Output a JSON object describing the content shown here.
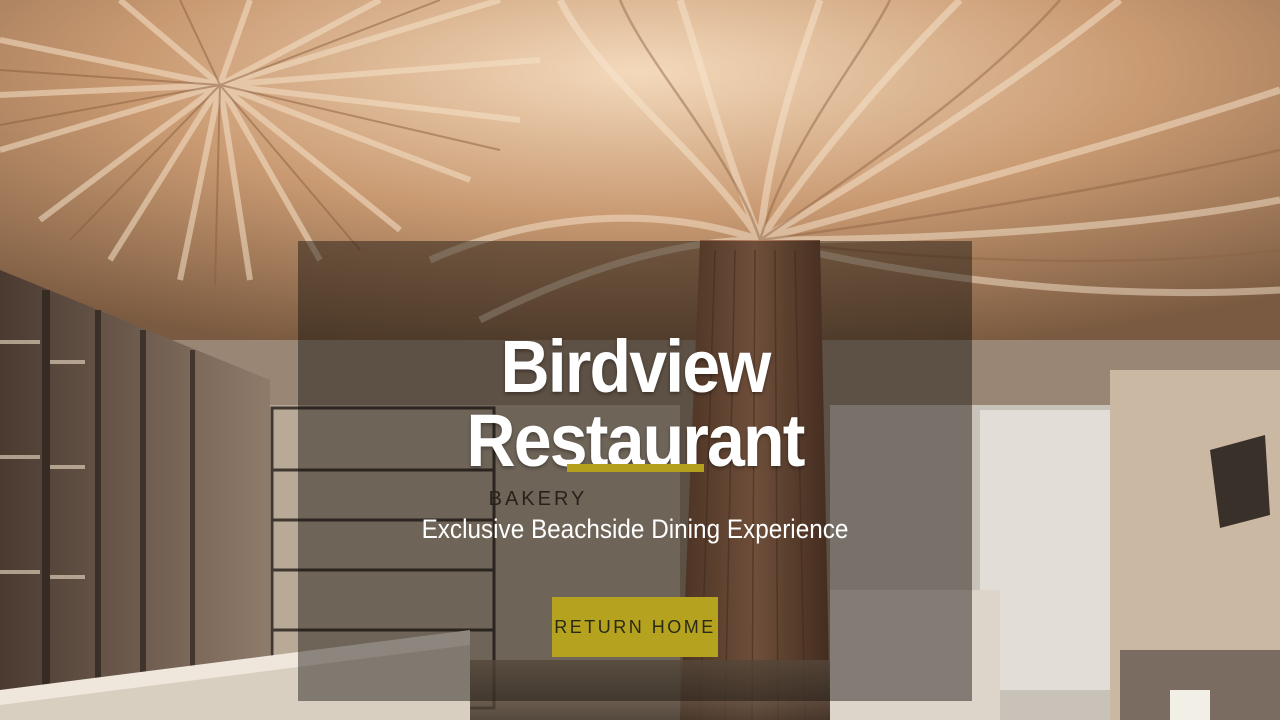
{
  "hero": {
    "title": "Birdview Restaurant",
    "subtitle": "Exclusive Beachside Dining Experience",
    "cta_label": "RETURN HOME",
    "background_sign": "BAKERY",
    "accent_color": "#b5a01e"
  }
}
